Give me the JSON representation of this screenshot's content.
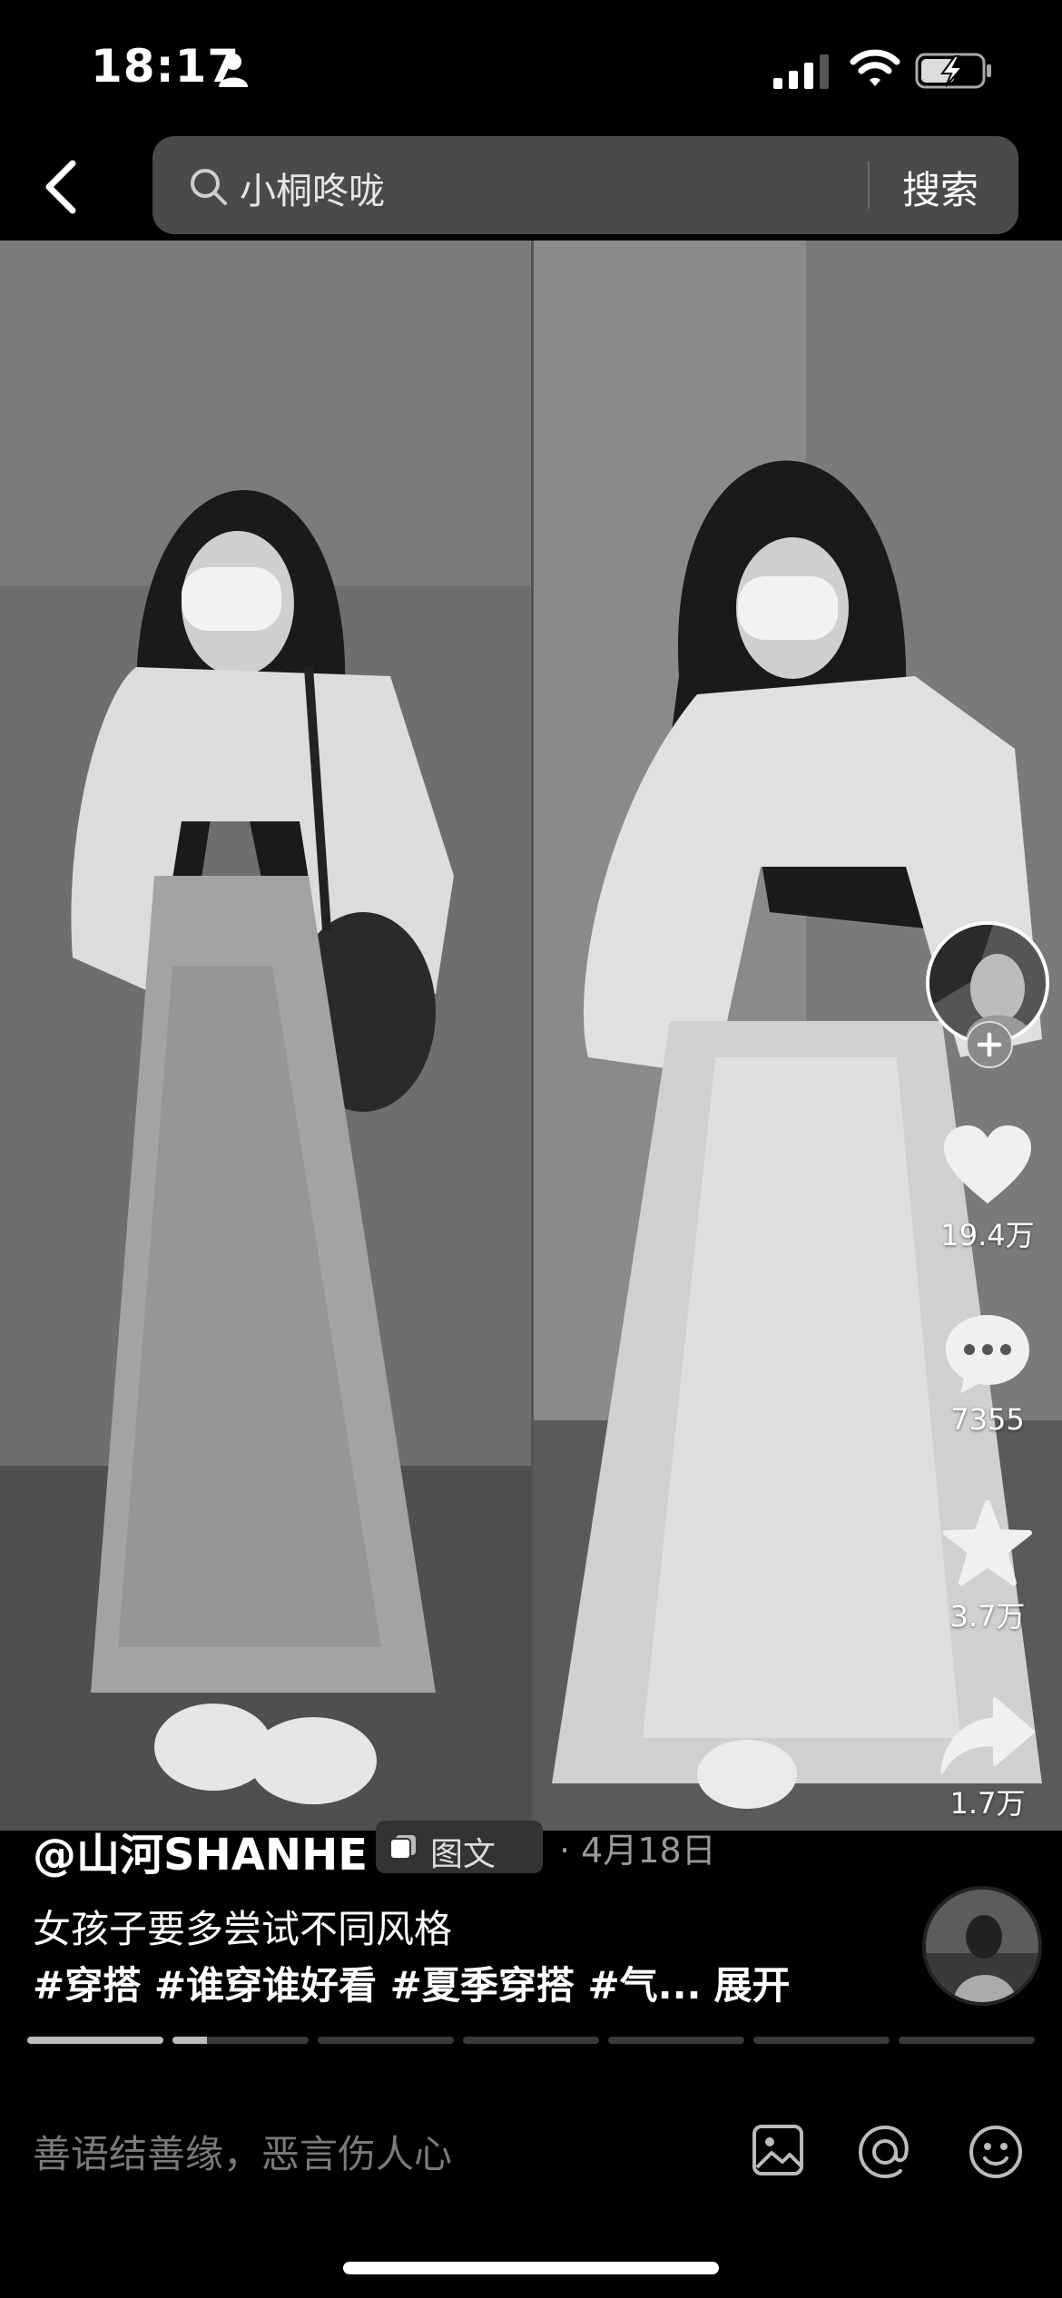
{
  "status_bar": {
    "time": "18:17"
  },
  "search": {
    "query": "小桐咚咙",
    "button_label": "搜索"
  },
  "rail": {
    "likes": "19.4万",
    "comments": "7355",
    "favorites": "3.7万",
    "shares": "1.7万"
  },
  "post": {
    "author": "@山河SHANHE",
    "type_badge": "图文",
    "date": "· 4月18日",
    "description": "女孩子要多尝试不同风格",
    "tags": "#穿搭 #谁穿谁好看 #夏季穿搭 #气...",
    "expand": "展开"
  },
  "progress": {
    "total": 7,
    "current_index": 1,
    "current_fill": 0.25
  },
  "comment_bar": {
    "placeholder": "善语结善缘，恶言伤人心"
  },
  "colors": {
    "background": "#000000",
    "search_bg": "#4a4a4a",
    "photo_tone": "grayscale"
  }
}
